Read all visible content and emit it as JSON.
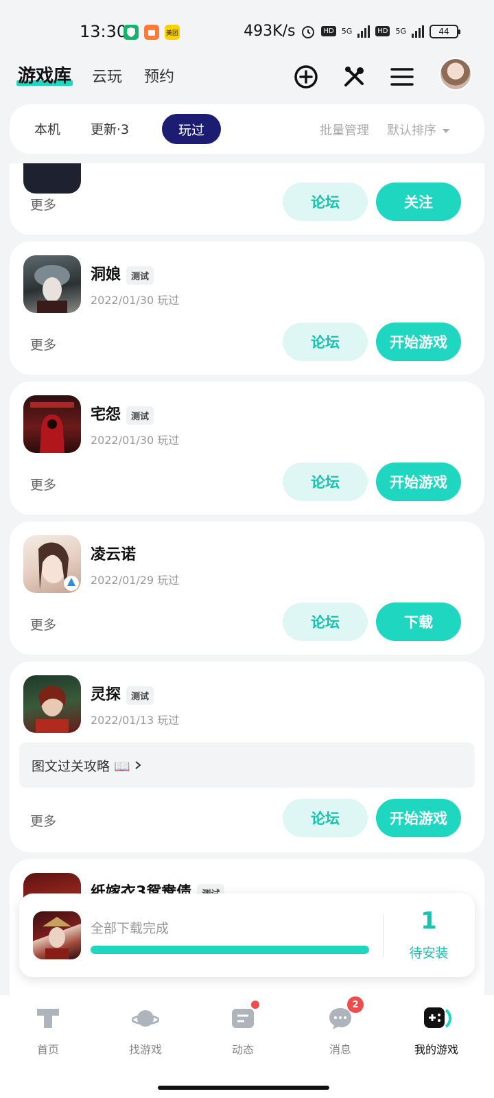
{
  "status_bar": {
    "time": "13:30",
    "apps": [
      "shield-app",
      "shop-app",
      "美团"
    ],
    "speed": "493K/s",
    "network_a": "5G",
    "network_b": "5G",
    "hd": "HD",
    "battery": "44"
  },
  "top_nav": {
    "tabs": [
      "游戏库",
      "云玩",
      "预约"
    ],
    "icons": [
      "add-circle-icon",
      "tools-icon",
      "menu-icon",
      "avatar"
    ]
  },
  "filter": {
    "tabs": [
      "本机",
      "更新·3",
      "玩过"
    ],
    "active_tab": "玩过",
    "batch": "批量管理",
    "sort": "默认排序"
  },
  "games": [
    {
      "title": "",
      "badge": "",
      "date": "",
      "more": "更多",
      "forum": "论坛",
      "action": "关注"
    },
    {
      "title": "洞娘",
      "badge": "测试",
      "date": "2022/01/30 玩过",
      "more": "更多",
      "forum": "论坛",
      "action": "开始游戏"
    },
    {
      "title": "宅怨",
      "badge": "测试",
      "date": "2022/01/30 玩过",
      "more": "更多",
      "forum": "论坛",
      "action": "开始游戏"
    },
    {
      "title": "凌云诺",
      "badge": "",
      "date": "2022/01/29 玩过",
      "more": "更多",
      "forum": "论坛",
      "action": "下载"
    },
    {
      "title": "灵探",
      "badge": "测试",
      "date": "2022/01/13 玩过",
      "guide": "图文过关攻略 📖",
      "more": "更多",
      "forum": "论坛",
      "action": "开始游戏"
    },
    {
      "title": "纸嫁衣3鸳鸯债",
      "badge": "测试",
      "date": ""
    }
  ],
  "download": {
    "text": "全部下载完成",
    "progress": 1.0,
    "count": "1",
    "label": "待安装"
  },
  "bottom_nav": {
    "items": [
      "首页",
      "找游戏",
      "动态",
      "消息",
      "我的游戏"
    ],
    "message_badge": "2",
    "active": "我的游戏"
  },
  "colors": {
    "accent": "#1fd6c0",
    "accent_light": "#dff7f4",
    "active_tab": "#1c1d72",
    "badge_red": "#f04b4b"
  }
}
